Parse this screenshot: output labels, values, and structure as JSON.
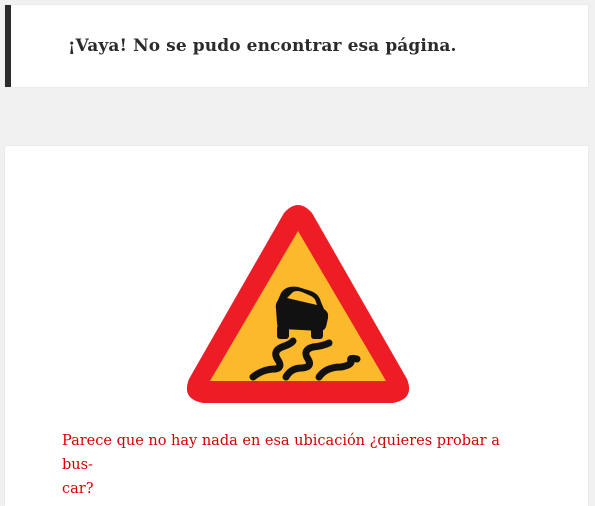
{
  "header": {
    "title": "¡Vaya! No se pudo encontrar esa página."
  },
  "content": {
    "image": {
      "icon": "slippery-road-warning-icon",
      "colors": {
        "border": "#ee1c25",
        "fill": "#fdb92c",
        "symbol": "#111111"
      }
    },
    "message_line1": "Parece que no hay nada en esa ubicación ¿quieres probar a bus-",
    "message_line2": "car?"
  },
  "colors": {
    "page_background": "#f1f1f1",
    "header_accent": "#2b2b2b",
    "message_text": "#d40000"
  }
}
